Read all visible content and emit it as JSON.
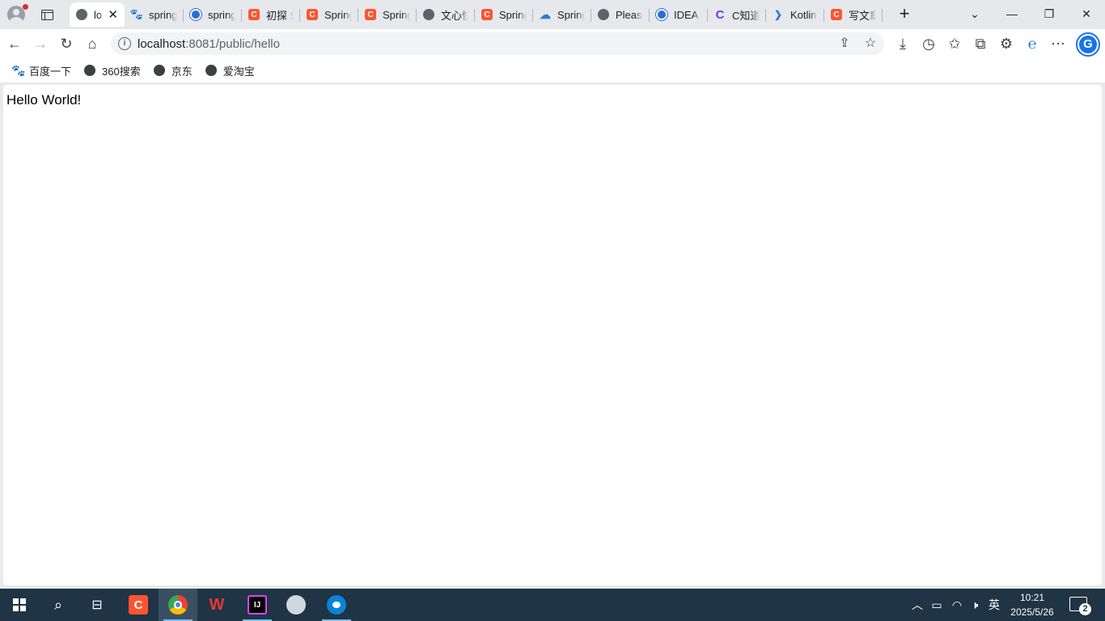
{
  "tabs": [
    {
      "title": "localhost",
      "favicon": "globe-icon",
      "active": true,
      "close": "✕"
    },
    {
      "title": "spring",
      "favicon": "baidu-icon"
    },
    {
      "title": "spring",
      "favicon": "circle-blue-icon"
    },
    {
      "title": "初探 S",
      "favicon": "csdn-icon"
    },
    {
      "title": "Spring",
      "favicon": "csdn-icon"
    },
    {
      "title": "Spring",
      "favicon": "csdn-icon"
    },
    {
      "title": "文心快",
      "favicon": "globe-icon"
    },
    {
      "title": "Spring",
      "favicon": "csdn-icon"
    },
    {
      "title": "Spring",
      "favicon": "cloud-icon"
    },
    {
      "title": "Please",
      "favicon": "globe-icon"
    },
    {
      "title": "IDEA",
      "favicon": "circle-blue-icon"
    },
    {
      "title": "C知道",
      "favicon": "c-purple-icon"
    },
    {
      "title": "Kotlin",
      "favicon": "kotlin-icon"
    },
    {
      "title": "写文章",
      "favicon": "csdn-icon"
    }
  ],
  "toolbar": {
    "back": "←",
    "forward": "→",
    "reload": "↻",
    "home": "⌂",
    "url_host": "localhost",
    "url_rest": ":8081/public/hello",
    "info": "i"
  },
  "bookmarks": [
    {
      "label": "百度一下",
      "icon": "baidu-icon"
    },
    {
      "label": "360搜索",
      "icon": "globe-icon"
    },
    {
      "label": "京东",
      "icon": "globe-icon"
    },
    {
      "label": "爱淘宝",
      "icon": "globe-icon"
    }
  ],
  "content": {
    "text": "Hello World!"
  },
  "taskbar": {
    "csdn_letter": "C",
    "wps_letter": "W",
    "idea_letter": "IJ",
    "ime": "英",
    "time": "10:21",
    "date": "2025/5/26",
    "notification_count": "2"
  },
  "colors": {
    "csdn": "#fc5531",
    "taskbar": "#1f3444",
    "accent": "#1a73e8"
  }
}
